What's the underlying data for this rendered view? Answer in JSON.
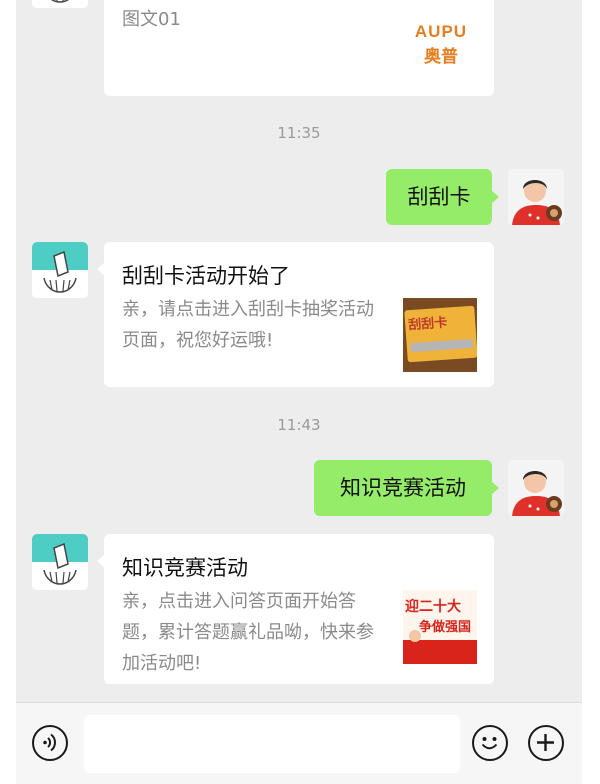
{
  "top_card": {
    "desc": "图文01",
    "brand_en": "AUPU",
    "brand_cn": "奥普"
  },
  "messages": [
    {
      "time": "11:35"
    },
    {
      "user_text": "刮刮卡"
    },
    {
      "card_title": "刮刮卡活动开始了",
      "card_desc": "亲，请点击进入刮刮卡抽奖活动页面，祝您好运哦!",
      "thumb_text": "刮刮卡"
    },
    {
      "time": "11:43"
    },
    {
      "user_text": "知识竞赛活动"
    },
    {
      "card_title": "知识竞赛活动",
      "card_desc": "亲，点击进入问答页面开始答题，累计答题赢礼品呦，快来参加活动吧!",
      "thumb_line1": "迎二十大",
      "thumb_line2": "争做强国"
    }
  ],
  "colors": {
    "chat_bg": "#ededed",
    "user_bubble": "#95ec69",
    "card_bg": "#ffffff",
    "thumb_orange": "#e8a23c",
    "thumb_red": "#d9241c"
  },
  "input_bar": {
    "voice_icon": "voice-icon",
    "emoji_icon": "emoji-icon",
    "plus_icon": "plus-icon"
  }
}
